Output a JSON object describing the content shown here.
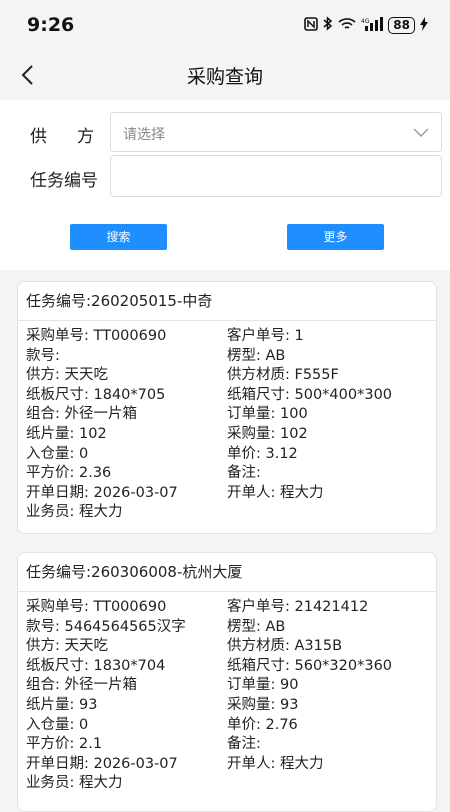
{
  "status_bar": {
    "time": "9:26",
    "battery": "88"
  },
  "header": {
    "title": "采购查询"
  },
  "search": {
    "supplier_label": "供方",
    "supplier_placeholder": "请选择",
    "task_label": "任务编号",
    "task_value": "",
    "search_button": "搜索",
    "more_button": "更多"
  },
  "records": [
    {
      "title": "任务编号:260205015-中奇",
      "rows": [
        [
          "采购单号: TT000690",
          "客户单号: 1"
        ],
        [
          "款号:",
          "楞型: AB"
        ],
        [
          "供方: 天天吃",
          "供方材质: F555F"
        ],
        [
          "纸板尺寸: 1840*705",
          "纸箱尺寸: 500*400*300"
        ],
        [
          "组合: 外径一片箱",
          "订单量: 100"
        ],
        [
          "纸片量: 102",
          "采购量: 102"
        ],
        [
          "入仓量: 0",
          "单价: 3.12"
        ],
        [
          "平方价: 2.36",
          "备注:"
        ],
        [
          "开单日期: 2026-03-07",
          "开单人: 程大力"
        ],
        [
          "业务员: 程大力",
          ""
        ]
      ]
    },
    {
      "title": "任务编号:260306008-杭州大厦",
      "rows": [
        [
          "采购单号: TT000690",
          "客户单号: 21421412"
        ],
        [
          "款号: 5464564565汉字",
          "楞型: AB"
        ],
        [
          "供方: 天天吃",
          "供方材质: A315B"
        ],
        [
          "纸板尺寸: 1830*704",
          "纸箱尺寸: 560*320*360"
        ],
        [
          "组合: 外径一片箱",
          "订单量: 90"
        ],
        [
          "纸片量: 93",
          "采购量: 93"
        ],
        [
          "入仓量: 0",
          "单价: 2.76"
        ],
        [
          "平方价: 2.1",
          "备注:"
        ],
        [
          "开单日期: 2026-03-07",
          "开单人: 程大力"
        ],
        [
          "业务员: 程大力",
          ""
        ]
      ]
    }
  ]
}
